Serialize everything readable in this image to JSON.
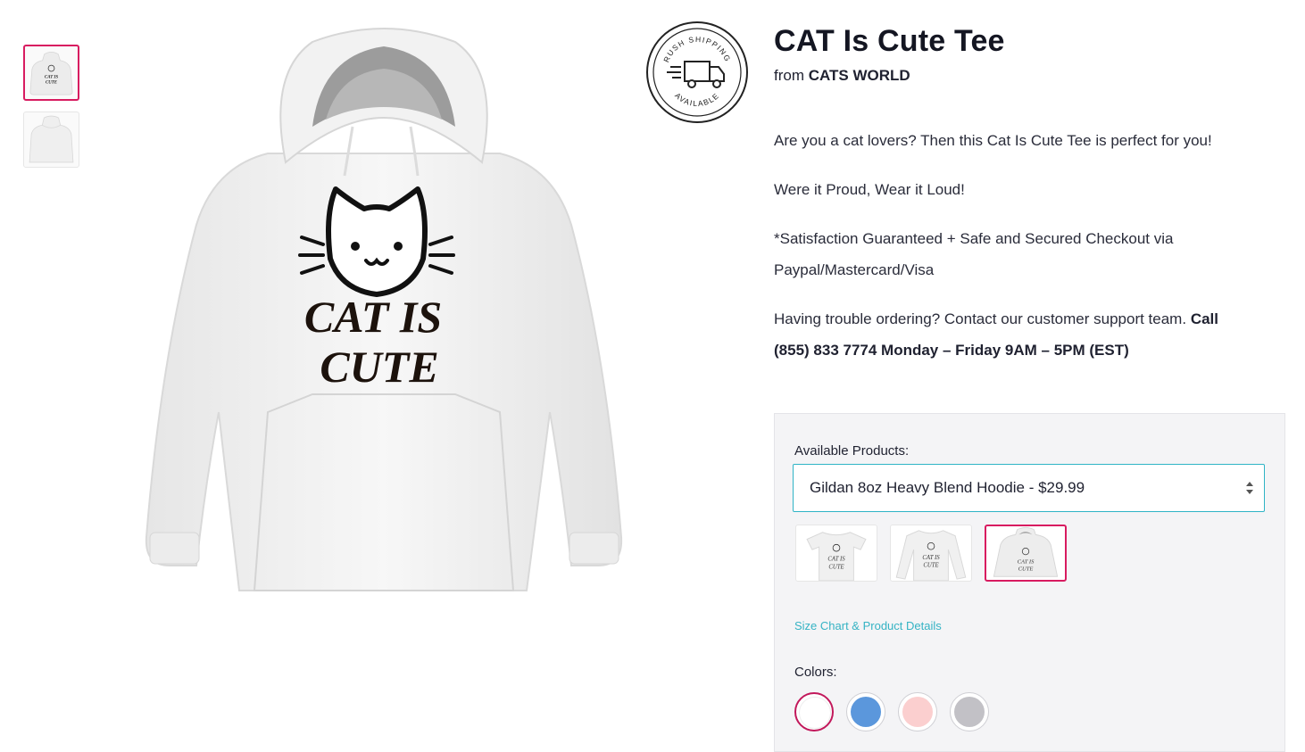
{
  "product": {
    "title": "CAT Is Cute Tee",
    "from_prefix": "from",
    "store_name": "CATS WORLD"
  },
  "design_text": {
    "line1": "CAT IS",
    "line2": "CUTE"
  },
  "badge": {
    "top_text": "RUSH SHIPPING",
    "bottom_text": "AVAILABLE"
  },
  "description": {
    "p1": "Are you a cat lovers? Then this Cat Is Cute Tee is perfect for you!",
    "p2": "Were it Proud, Wear it Loud!",
    "p3_line1": "*Satisfaction Guaranteed + Safe and Secured Checkout via",
    "p3_line2": "Paypal/Mastercard/Visa",
    "p4_intro": "Having trouble ordering? Contact our customer support team.",
    "p4_call": "Call",
    "p4_hours": "(855) 833 7774 Monday – Friday 9AM – 5PM (EST)"
  },
  "purchase": {
    "products_label": "Available Products:",
    "selected_product": "Gildan 8oz Heavy Blend Hoodie - $29.99",
    "size_link": "Size Chart & Product Details",
    "colors_label": "Colors:",
    "colors": [
      "#ffffff",
      "#5b97dc",
      "#fbcfcf",
      "#c2c1c6"
    ],
    "selected_color_index": 0,
    "accent": "#d81b60",
    "link_color": "#35b3c4"
  },
  "icons": {
    "select": "up-down-chevrons-icon",
    "badge": "delivery-truck-icon",
    "design": "cat-face-icon"
  }
}
